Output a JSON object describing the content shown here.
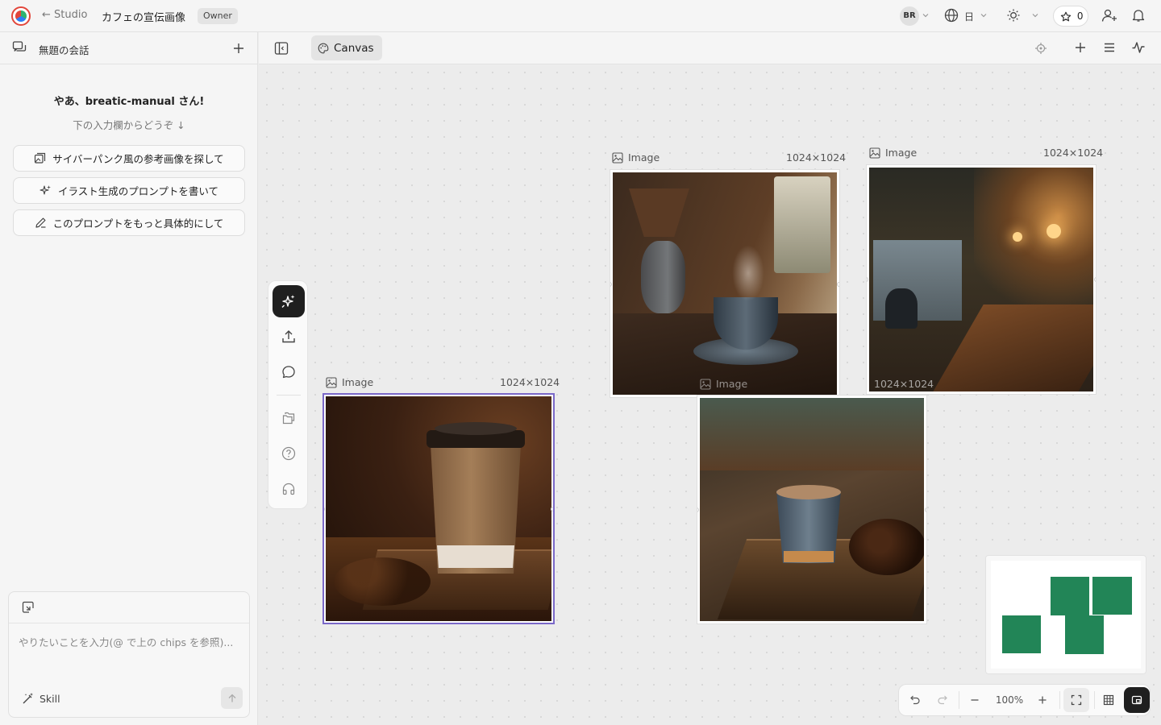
{
  "topbar": {
    "back_label": "← Studio",
    "project_title": "カフェの宣伝画像",
    "role_badge": "Owner",
    "user_initials": "BR",
    "language": "日",
    "star_count": "0"
  },
  "sidebar": {
    "header_title": "無題の会話",
    "greeting": "やあ、breatic-manual さん!",
    "subtext": "下の入力欄からどうぞ ↓",
    "chips": [
      {
        "label": "サイバーパンク風の参考画像を探して",
        "icon": "image-search-icon"
      },
      {
        "label": "イラスト生成のプロンプトを書いて",
        "icon": "sparkle-icon"
      },
      {
        "label": "このプロンプトをもっと具体的にして",
        "icon": "pencil-icon"
      }
    ],
    "composer": {
      "placeholder": "やりたいことを入力(@ で上の chips を参照)...",
      "skill_label": "Skill"
    }
  },
  "canvas_toolbar": {
    "tab_label": "Canvas"
  },
  "canvas": {
    "nodes": [
      {
        "type_label": "Image",
        "size_label": "1024×1024",
        "subject": "paper coffee cup on wooden board with beans",
        "selected": true
      },
      {
        "type_label": "Image",
        "size_label": "1024×1024",
        "subject": "steaming ceramic cup by window",
        "selected": false
      },
      {
        "type_label": "Image",
        "size_label": "1024×1024",
        "subject": "cafe interior with bar and pendant lights",
        "selected": false
      },
      {
        "type_label": "Image",
        "size_label": "1024×1024",
        "subject": "small blue cup on wooden board with beans",
        "selected": false
      }
    ]
  },
  "zoom": {
    "level": "100%"
  },
  "colors": {
    "accent_selection": "#7a68c8",
    "minimap_node": "#228557",
    "primary_dark": "#1f1f1f"
  }
}
